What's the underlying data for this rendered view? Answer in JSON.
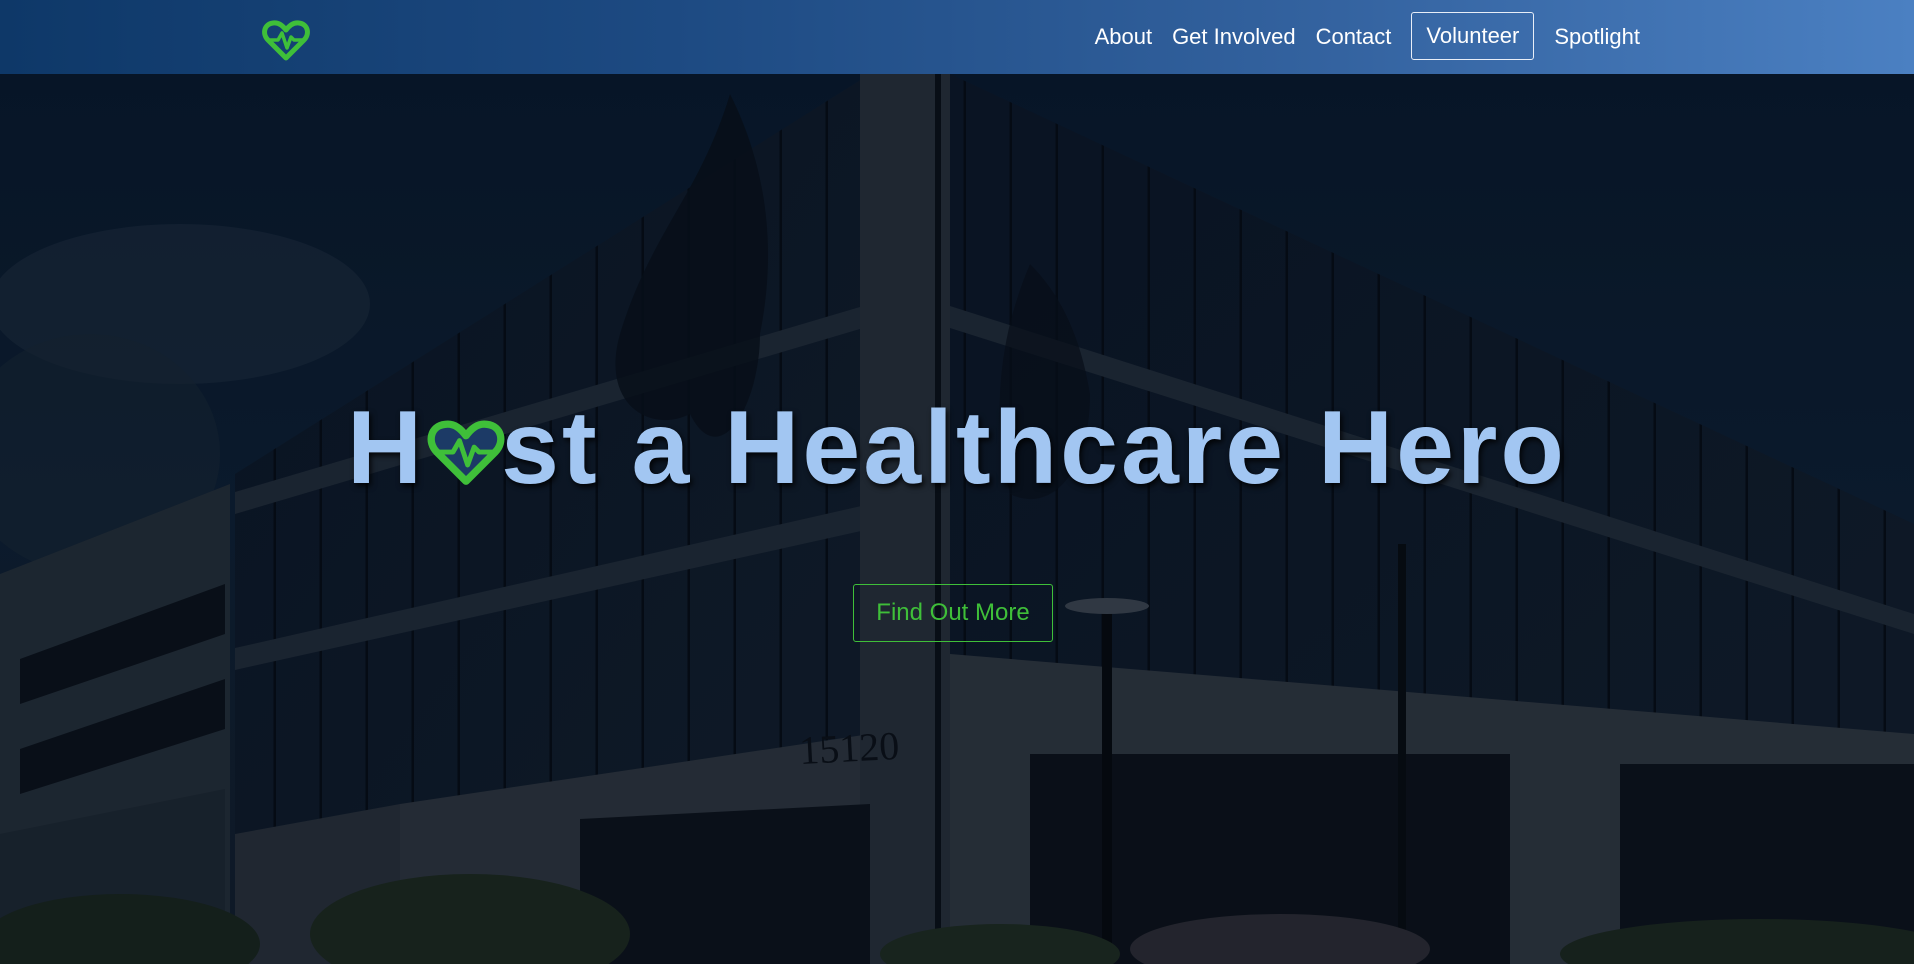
{
  "nav": {
    "logo_icon": "heart-pulse-icon",
    "links": [
      {
        "label": "About"
      },
      {
        "label": "Get Involved"
      },
      {
        "label": "Contact"
      },
      {
        "label": "Volunteer"
      },
      {
        "label": "Spotlight"
      }
    ]
  },
  "hero": {
    "title_prefix": "H",
    "title_suffix": "st a Healthcare Hero",
    "heart_icon": "heart-pulse-icon",
    "cta_label": "Find Out More",
    "building_number": "15120"
  },
  "colors": {
    "accent_green": "#3fbf39",
    "title_blue": "#a2c6f2",
    "nav_start": "#0e3868",
    "nav_end": "#4b80c2"
  }
}
